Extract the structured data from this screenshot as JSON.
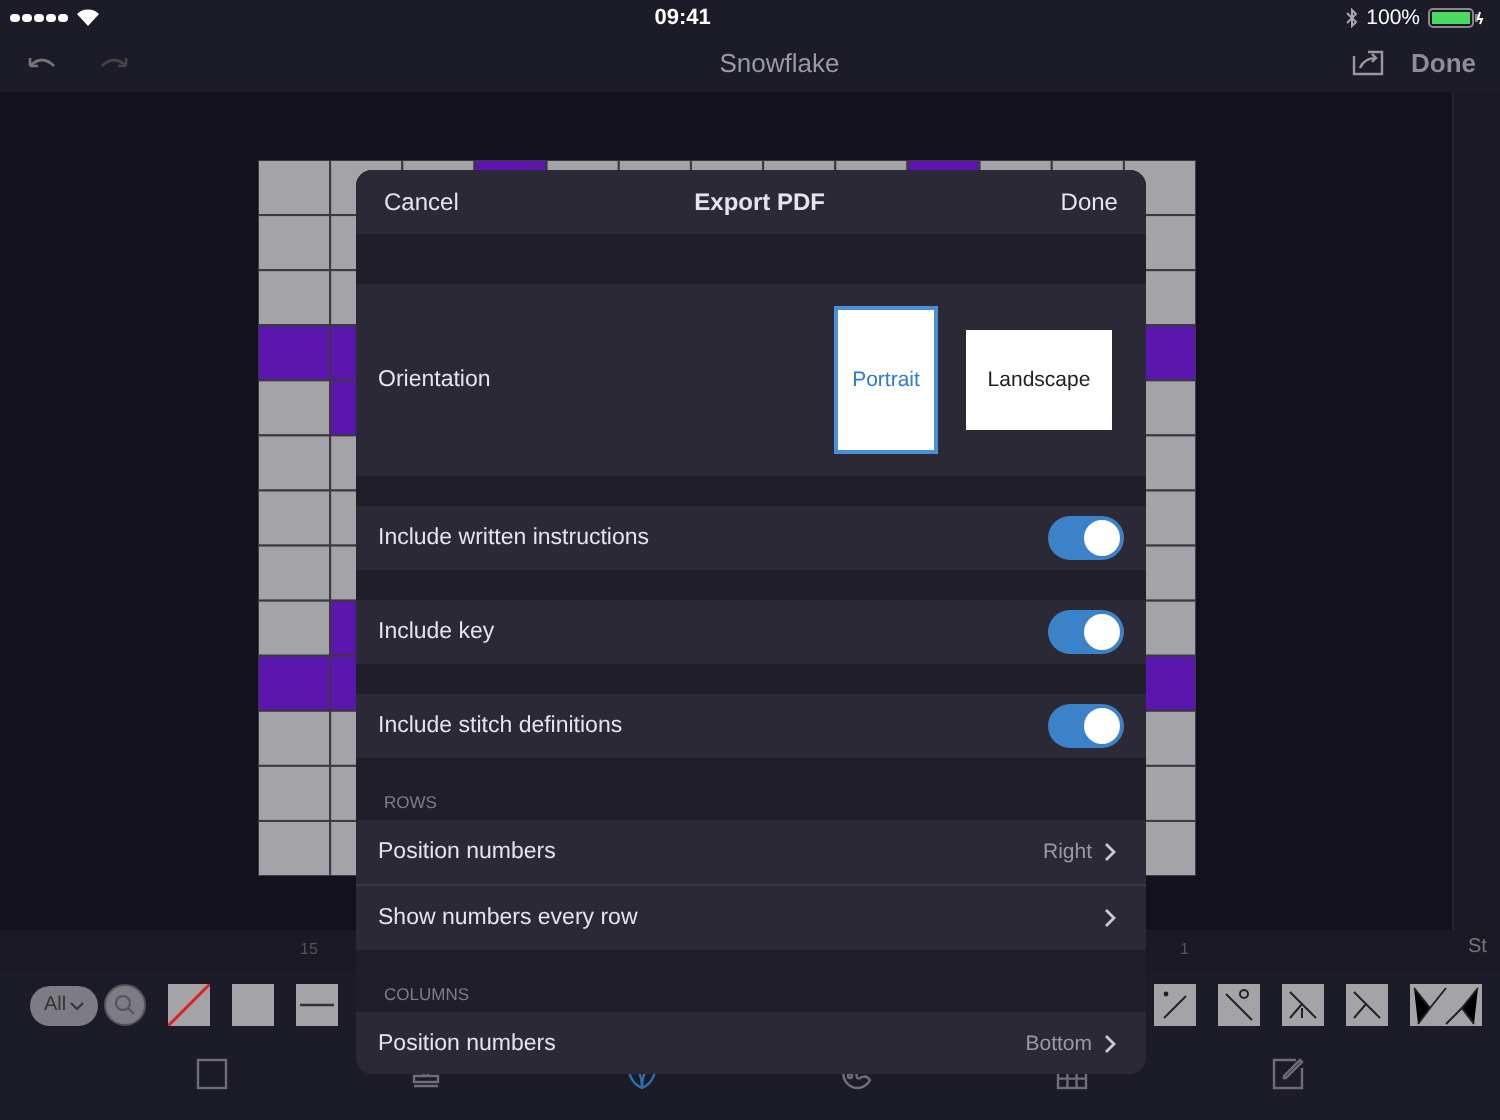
{
  "status_bar": {
    "time": "09:41",
    "battery": "100%"
  },
  "nav": {
    "title": "Snowflake",
    "done": "Done"
  },
  "ruler": {
    "labels": [
      "15",
      "1",
      "St"
    ]
  },
  "toolbar": {
    "filter": "All"
  },
  "dialog": {
    "cancel": "Cancel",
    "title": "Export PDF",
    "done": "Done",
    "orientation": {
      "label": "Orientation",
      "options": [
        {
          "label": "Portrait",
          "selected": true
        },
        {
          "label": "Landscape",
          "selected": false
        }
      ]
    },
    "toggles": [
      {
        "label": "Include written instructions",
        "on": true
      },
      {
        "label": "Include key",
        "on": true
      },
      {
        "label": "Include stitch definitions",
        "on": true
      }
    ],
    "sections": [
      {
        "header": "ROWS",
        "rows": [
          {
            "label": "Position numbers",
            "value": "Right"
          },
          {
            "label": "Show numbers every row"
          }
        ]
      },
      {
        "header": "COLUMNS",
        "rows": [
          {
            "label": "Position numbers",
            "value": "Bottom"
          }
        ]
      }
    ]
  },
  "tabs": [
    {
      "selected": false
    },
    {
      "selected": false
    },
    {
      "selected": true
    },
    {
      "selected": false
    },
    {
      "selected": false
    },
    {
      "selected": false
    }
  ]
}
